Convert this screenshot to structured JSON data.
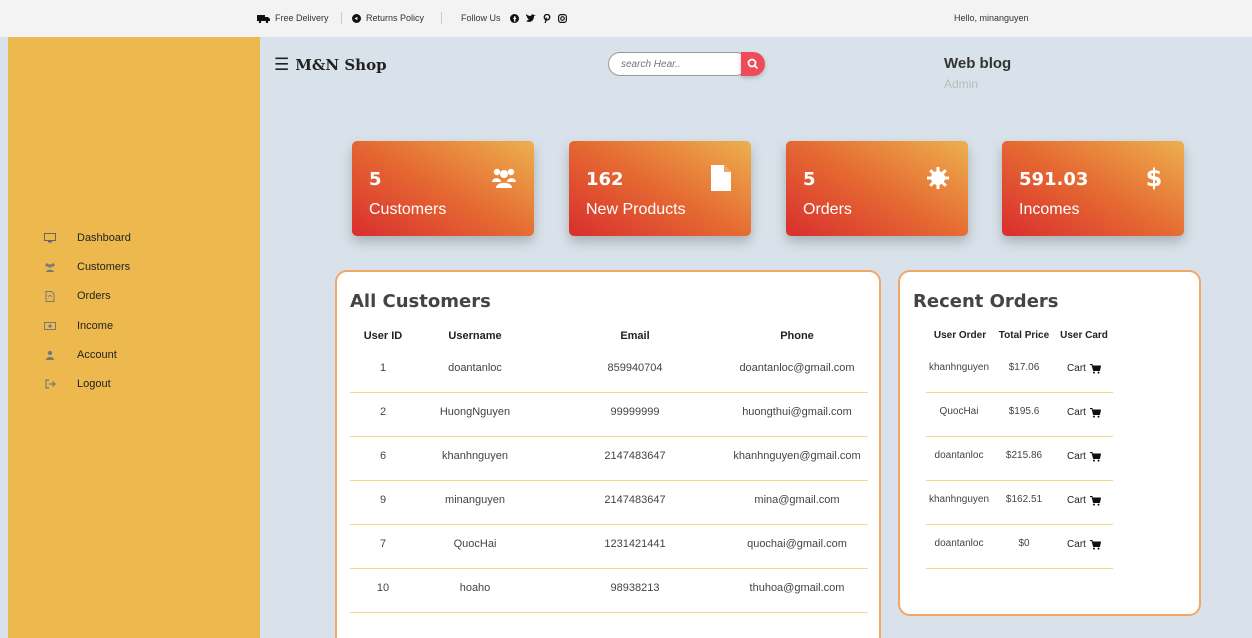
{
  "topbar": {
    "free_delivery": "Free Delivery",
    "returns_policy": "Returns Policy",
    "follow_us": "Follow Us",
    "greeting": "Hello, minanguyen"
  },
  "sidebar": {
    "items": [
      {
        "label": "Dashboard",
        "icon": "monitor-icon"
      },
      {
        "label": "Customers",
        "icon": "users-icon"
      },
      {
        "label": "Orders",
        "icon": "file-icon"
      },
      {
        "label": "Income",
        "icon": "money-icon"
      },
      {
        "label": "Account",
        "icon": "user-icon"
      },
      {
        "label": "Logout",
        "icon": "logout-icon"
      }
    ]
  },
  "header": {
    "brand": "M&N Shop",
    "search_placeholder": "search Hear..",
    "blog_title": "Web blog",
    "blog_subtitle": "Admin"
  },
  "stats": [
    {
      "value": "5",
      "label": "Customers",
      "icon": "users-icon"
    },
    {
      "value": "162",
      "label": "New Products",
      "icon": "file-icon"
    },
    {
      "value": "5",
      "label": "Orders",
      "icon": "gear-icon"
    },
    {
      "value": "591.03",
      "label": "Incomes",
      "icon": "dollar-icon"
    }
  ],
  "customers": {
    "title": "All Customers",
    "columns": [
      "User ID",
      "Username",
      "Email",
      "Phone"
    ],
    "rows": [
      [
        "1",
        "doantanloc",
        "859940704",
        "doantanloc@gmail.com"
      ],
      [
        "2",
        "HuongNguyen",
        "99999999",
        "huongthui@gmail.com"
      ],
      [
        "6",
        "khanhnguyen",
        "2147483647",
        "khanhnguyen@gmail.com"
      ],
      [
        "9",
        "minanguyen",
        "2147483647",
        "mina@gmail.com"
      ],
      [
        "7",
        "QuocHai",
        "1231421441",
        "quochai@gmail.com"
      ],
      [
        "10",
        "hoaho",
        "98938213",
        "thuhoa@gmail.com"
      ]
    ]
  },
  "orders": {
    "title": "Recent Orders",
    "columns": [
      "User Order",
      "Total Price",
      "User Card"
    ],
    "cart_label": "Cart",
    "rows": [
      [
        "khanhnguyen",
        "$17.06"
      ],
      [
        "QuocHai",
        "$195.6"
      ],
      [
        "doantanloc",
        "$215.86"
      ],
      [
        "khanhnguyen",
        "$162.51"
      ],
      [
        "doantanloc",
        "$0"
      ]
    ]
  },
  "colors": {
    "sidebar": "#edb94f",
    "background": "#d9e2ea",
    "accent": "#ef4b5b",
    "panel_border": "#f0a866",
    "row_divider": "#f5d98a"
  }
}
